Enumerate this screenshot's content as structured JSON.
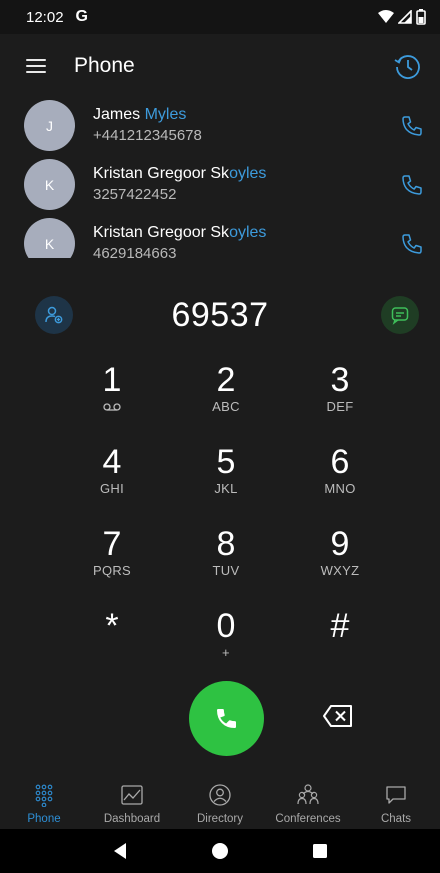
{
  "status_bar": {
    "time": "12:02",
    "g_glyph": "G"
  },
  "app_bar": {
    "title": "Phone",
    "menu_icon": "hamburger-menu-icon",
    "history_icon": "history-icon"
  },
  "contacts": [
    {
      "initial": "J",
      "name_plain": "James ",
      "name_highlight": "Myles",
      "number": "+441212345678"
    },
    {
      "initial": "K",
      "name_plain": "Kristan Gregoor Sk",
      "name_highlight": "oyles",
      "number": "3257422452"
    },
    {
      "initial": "K",
      "name_plain": "Kristan Gregoor Sk",
      "name_highlight": "oyles",
      "number": "4629184663"
    }
  ],
  "dialer": {
    "number": "69537"
  },
  "keypad": [
    {
      "digit": "1",
      "letters": ""
    },
    {
      "digit": "2",
      "letters": "ABC"
    },
    {
      "digit": "3",
      "letters": "DEF"
    },
    {
      "digit": "4",
      "letters": "GHI"
    },
    {
      "digit": "5",
      "letters": "JKL"
    },
    {
      "digit": "6",
      "letters": "MNO"
    },
    {
      "digit": "7",
      "letters": "PQRS"
    },
    {
      "digit": "8",
      "letters": "TUV"
    },
    {
      "digit": "9",
      "letters": "WXYZ"
    },
    {
      "digit": "*",
      "letters": ""
    },
    {
      "digit": "0",
      "letters": "+"
    },
    {
      "digit": "#",
      "letters": ""
    }
  ],
  "bottom_nav": [
    {
      "label": "Phone",
      "icon": "dialpad-icon",
      "active": true
    },
    {
      "label": "Dashboard",
      "icon": "dashboard-chart-icon",
      "active": false
    },
    {
      "label": "Directory",
      "icon": "directory-icon",
      "active": false
    },
    {
      "label": "Conferences",
      "icon": "conferences-icon",
      "active": false
    },
    {
      "label": "Chats",
      "icon": "chat-bubble-icon",
      "active": false
    }
  ],
  "colors": {
    "accent_blue": "#2e8fd6",
    "call_green": "#2ec242",
    "background": "#1c1c1c",
    "avatar_grey": "#a7adbc"
  }
}
